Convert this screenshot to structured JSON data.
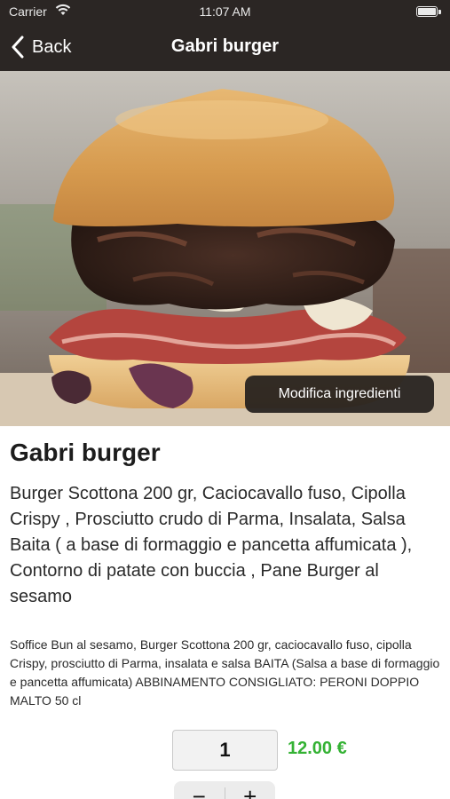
{
  "status_bar": {
    "carrier": "Carrier",
    "time": "11:07 AM"
  },
  "nav": {
    "back_label": "Back",
    "title": "Gabri burger"
  },
  "hero": {
    "modify_button_label": "Modifica ingredienti"
  },
  "product": {
    "title": "Gabri burger",
    "short_description": "Burger Scottona 200 gr, Caciocavallo fuso, Cipolla Crispy , Prosciutto crudo di Parma, Insalata, Salsa Baita ( a base di formaggio e pancetta affumicata ), Contorno di patate con buccia , Pane Burger al sesamo",
    "long_description": "Soffice Bun al sesamo, Burger Scottona 200 gr, caciocavallo fuso, cipolla Crispy, prosciutto di Parma, insalata e salsa BAITA (Salsa a base di formaggio e pancetta affumicata) ABBINAMENTO CONSIGLIATO: PERONI DOPPIO MALTO 50 cl"
  },
  "order": {
    "quantity": "1",
    "price": "12.00 €",
    "decrement_label": "−",
    "increment_label": "+"
  },
  "colors": {
    "nav_background": "#2b2624",
    "price_green": "#34b234"
  },
  "icons": {
    "back": "chevron-left-icon",
    "wifi": "wifi-icon",
    "battery": "battery-icon"
  }
}
